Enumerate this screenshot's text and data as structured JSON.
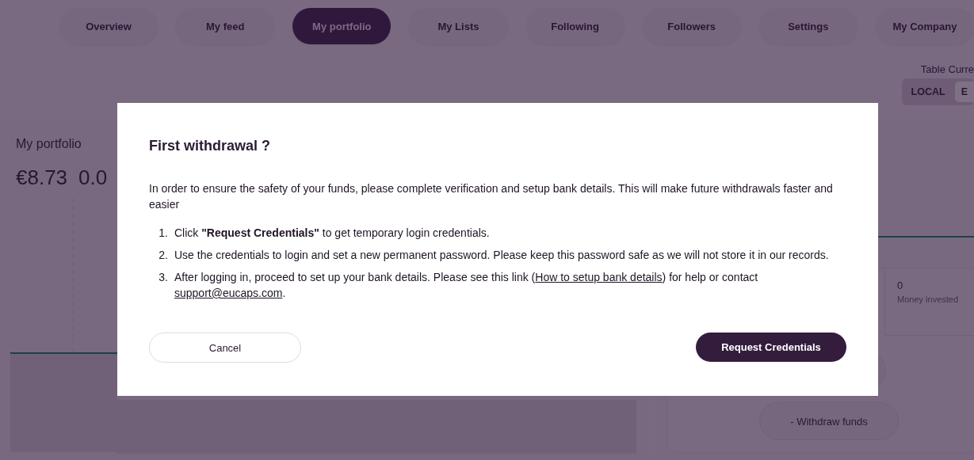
{
  "nav": {
    "tabs": [
      {
        "label": "Overview",
        "selected": false
      },
      {
        "label": "My feed",
        "selected": false
      },
      {
        "label": "My portfolio",
        "selected": true
      },
      {
        "label": "My Lists",
        "selected": false
      },
      {
        "label": "Following",
        "selected": false
      },
      {
        "label": "Followers",
        "selected": false
      },
      {
        "label": "Settings",
        "selected": false
      },
      {
        "label": "My Company",
        "selected": false
      }
    ]
  },
  "currency": {
    "label": "Table Curre",
    "options": [
      {
        "label": "LOCAL",
        "selected": false
      },
      {
        "label": "E",
        "selected": true
      }
    ]
  },
  "portfolio": {
    "title": "My portfolio",
    "value": "€8.73",
    "change": "0.0"
  },
  "side_panel": {
    "stats": [
      {
        "value": "0",
        "label": "Money invested"
      }
    ],
    "withdraw_button": "- Withdraw funds"
  },
  "dialog": {
    "title": "First withdrawal ?",
    "intro": "In order to ensure the safety of your funds, please complete verification and setup bank details. This will make future withdrawals faster and easier",
    "steps": [
      {
        "number": "1.",
        "text": "Click **\"Request Credentials\"** to get temporary login credentials."
      },
      {
        "number": "2.",
        "text": "Use the credentials to login and set a new permanent password. Please keep this password safe as we will not store it in our records."
      },
      {
        "number": "3.",
        "text": "After logging in, proceed to set up your bank details. Please see this link (",
        "link": "How to setup bank details",
        "text_after_link": ") for help or contact ",
        "email": "support@eucaps.com",
        "text_end": "."
      }
    ],
    "cancel_button": "Cancel",
    "confirm_button": "Request Credentials"
  }
}
